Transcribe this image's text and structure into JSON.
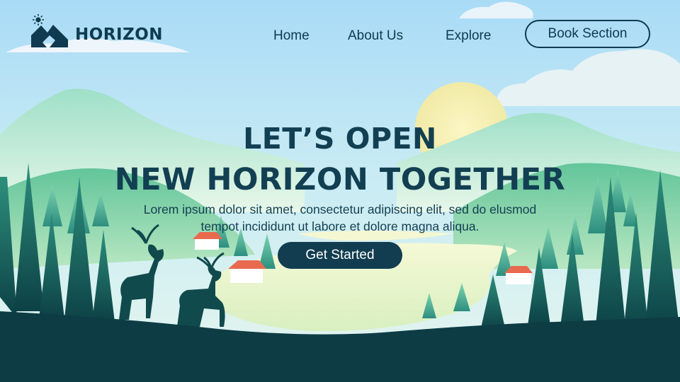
{
  "brand": {
    "name": "HORIZON",
    "logo_icon": "mountain-logo-icon",
    "sun_icon": "sun-icon"
  },
  "nav": {
    "links": [
      "Home",
      "About Us",
      "Explore"
    ],
    "cta_label": "Book Section"
  },
  "hero": {
    "title_line1": "LET’S OPEN",
    "title_line2": "NEW HORIZON TOGETHER",
    "subtitle_line1": "Lorem ipsum dolor sit amet, consectetur adipiscing elit, sed do elusmod",
    "subtitle_line2": "tempot incididunt ut labore et dolore magna aliqua.",
    "button_label": "Get Started"
  },
  "colors": {
    "brand_dark": "#0f3a4f",
    "sky_top": "#a9dbf6",
    "sky_bottom": "#dff3f5",
    "sun": "#f6f1b8",
    "forest_dark": "#0e4a4e",
    "forest_mid": "#2f9a86",
    "meadow": "#7fd3a6",
    "lake": "#eef6c9"
  }
}
